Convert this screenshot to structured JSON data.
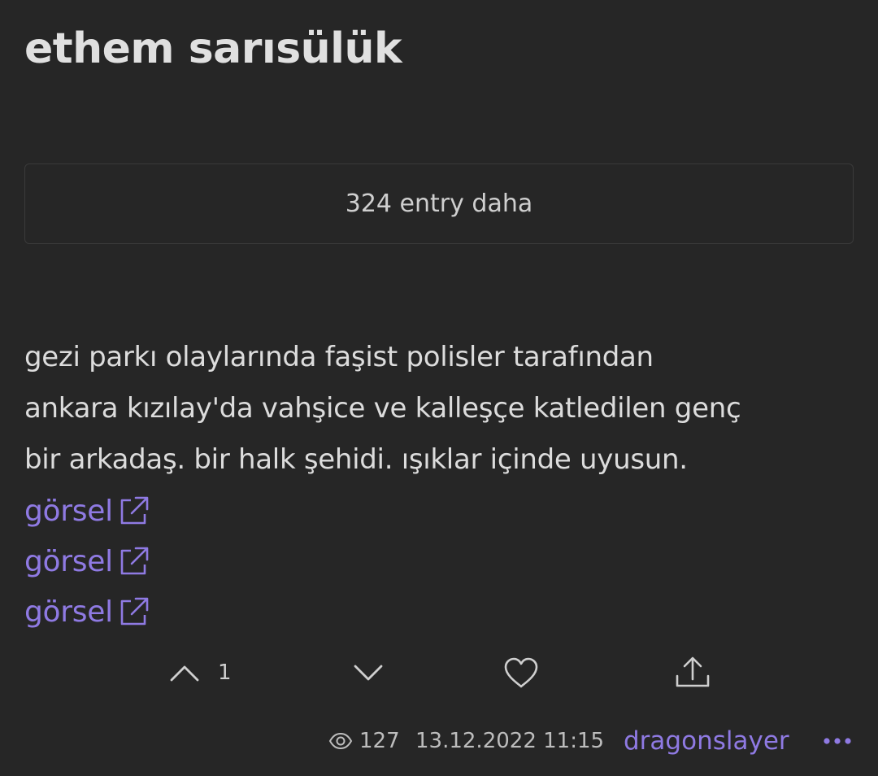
{
  "topic": {
    "title": "ethem sarısülük"
  },
  "more_entries": {
    "label": "324 entry daha"
  },
  "entry": {
    "lines": [
      "gezi parkı olaylarında faşist polisler tarafından",
      "ankara kızılay'da vahşice ve kalleşçe katledilen genç",
      "bir arkadaş. bir halk şehidi. ışıklar içinde uyusun."
    ],
    "links": [
      {
        "label": "görsel",
        "icon": "external-link-icon"
      },
      {
        "label": "görsel",
        "icon": "external-link-icon"
      },
      {
        "label": "görsel",
        "icon": "external-link-icon"
      }
    ]
  },
  "actions": {
    "upvote_icon": "chevron-up-icon",
    "upvote_count": "1",
    "downvote_icon": "chevron-down-icon",
    "favorite_icon": "heart-icon",
    "share_icon": "share-icon"
  },
  "footer": {
    "view_icon": "eye-icon",
    "views": "127",
    "date": "13.12.2022 11:15",
    "author": "dragonslayer",
    "more_icon": "more-horizontal-icon"
  },
  "colors": {
    "background": "#262626",
    "text": "#dcdcdc",
    "accent": "#8f7ae3",
    "border": "#3a3a3a"
  }
}
